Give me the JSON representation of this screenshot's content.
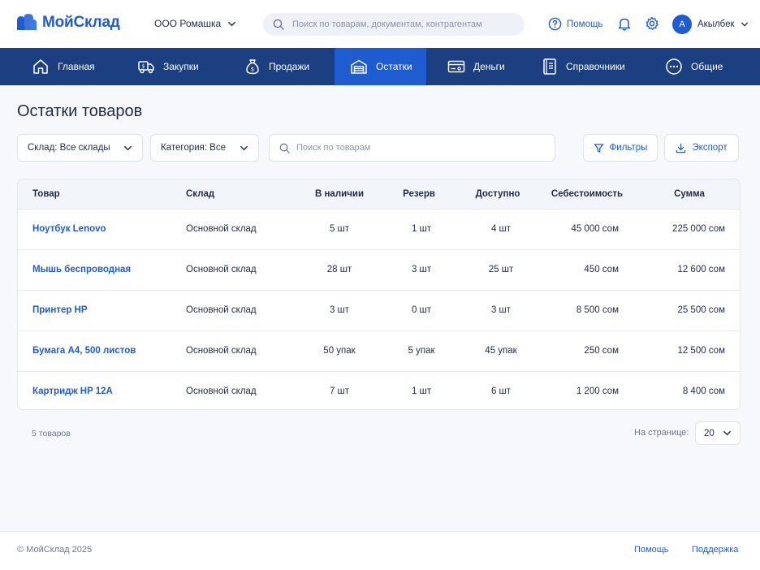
{
  "header": {
    "brand": "МойСклад",
    "company": "ООО Ромашка",
    "search_placeholder": "Поиск по товарам, документам, контрагентам",
    "help_label": "Помощь",
    "user_initial": "А",
    "user_name": "Акылбек"
  },
  "nav": {
    "items": [
      {
        "label": "Главная",
        "icon": "home-icon"
      },
      {
        "label": "Закупки",
        "icon": "truck-icon"
      },
      {
        "label": "Продажи",
        "icon": "money-bag-icon"
      },
      {
        "label": "Остатки",
        "icon": "warehouse-icon",
        "active": true
      },
      {
        "label": "Деньги",
        "icon": "card-icon"
      },
      {
        "label": "Справочники",
        "icon": "book-icon"
      },
      {
        "label": "Общие",
        "icon": "more-icon"
      }
    ]
  },
  "page": {
    "title": "Остатки товаров",
    "warehouse_filter": "Склад: Все склады",
    "category_filter": "Категория: Все",
    "search_placeholder": "Поиск по товарам",
    "filters_label": "Фильтры",
    "export_label": "Экспорт"
  },
  "table": {
    "columns": [
      "Товар",
      "Склад",
      "В наличии",
      "Резерв",
      "Доступно",
      "Себестоимость",
      "Сумма"
    ],
    "rows": [
      {
        "product": "Ноутбук Lenovo",
        "warehouse": "Основной склад",
        "in_stock": "5 шт",
        "reserve": "1 шт",
        "available": "4 шт",
        "cost": "45 000 сом",
        "sum": "225 000 сом"
      },
      {
        "product": "Мышь беспроводная",
        "warehouse": "Основной склад",
        "in_stock": "28 шт",
        "reserve": "3 шт",
        "available": "25 шт",
        "cost": "450 сом",
        "sum": "12 600 сом"
      },
      {
        "product": "Принтер HP",
        "warehouse": "Основной склад",
        "in_stock": "3 шт",
        "reserve": "0 шт",
        "available": "3 шт",
        "cost": "8 500 сом",
        "sum": "25 500 сом"
      },
      {
        "product": "Бумага А4, 500 листов",
        "warehouse": "Основной склад",
        "in_stock": "50 упак",
        "reserve": "5 упак",
        "available": "45 упак",
        "cost": "250 сом",
        "sum": "12 500 сом"
      },
      {
        "product": "Картридж HP 12A",
        "warehouse": "Основной склад",
        "in_stock": "7 шт",
        "reserve": "1 шт",
        "available": "6 шт",
        "cost": "1 200 сом",
        "sum": "8 400 сом"
      }
    ]
  },
  "pagination": {
    "count": "5 товаров",
    "per_page_label": "На странице:",
    "per_page_value": "20"
  },
  "footer": {
    "copyright": "© МойСклад 2025",
    "help": "Помощь",
    "support": "Поддержка"
  }
}
